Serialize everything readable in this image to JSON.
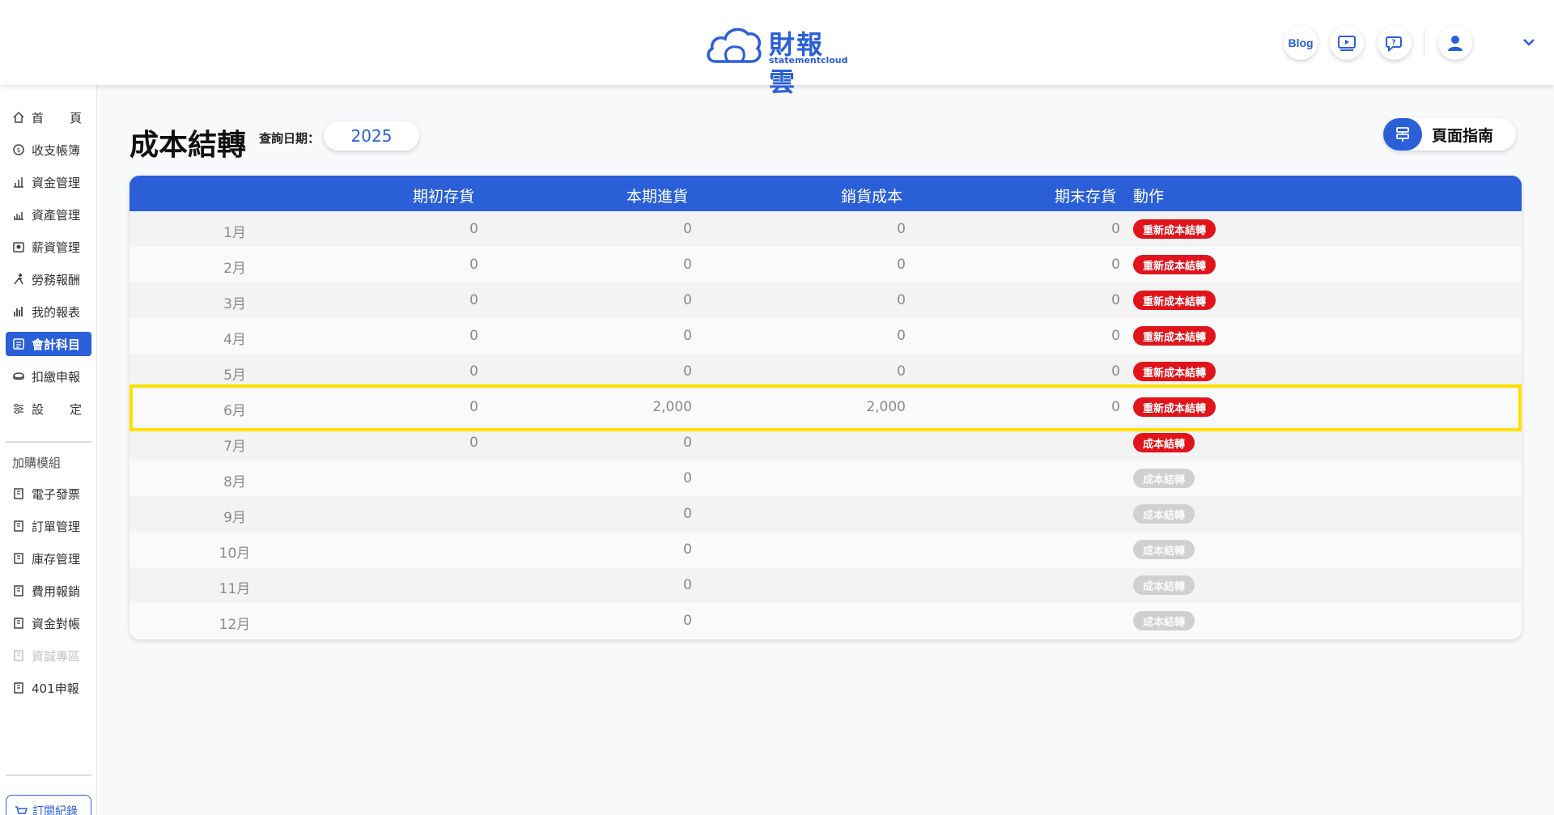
{
  "header": {
    "logo_text": "財報雲",
    "logo_sub": "statementcloud",
    "blog_label": "Blog",
    "icons": [
      "video-icon",
      "chat-question-icon",
      "user-icon",
      "chevron-down-icon"
    ]
  },
  "sidebar": {
    "items": [
      {
        "label_a": "首",
        "label_b": "頁",
        "icon": "home-icon"
      },
      {
        "label": "收支帳簿",
        "icon": "ledger-icon"
      },
      {
        "label": "資金管理",
        "icon": "fund-icon"
      },
      {
        "label": "資產管理",
        "icon": "asset-icon"
      },
      {
        "label": "薪資管理",
        "icon": "salary-icon"
      },
      {
        "label": "勞務報酬",
        "icon": "labor-icon"
      },
      {
        "label": "我的報表",
        "icon": "report-icon"
      },
      {
        "label": "會計科目",
        "icon": "account-icon"
      },
      {
        "label": "扣繳申報",
        "icon": "withholding-icon"
      },
      {
        "label_a": "設",
        "label_b": "定",
        "icon": "settings-icon"
      }
    ],
    "section_title": "加購模組",
    "addons": [
      {
        "label": "電子發票"
      },
      {
        "label": "訂單管理"
      },
      {
        "label": "庫存管理"
      },
      {
        "label": "費用報銷"
      },
      {
        "label": "資金對帳"
      },
      {
        "label": "資誠專區"
      },
      {
        "label": "401申報"
      }
    ],
    "subscription_label": "訂閱紀錄"
  },
  "main": {
    "title": "成本結轉",
    "date_label": "查詢日期：",
    "date_value": "2025",
    "guide_label": "頁面指南"
  },
  "table": {
    "headers": [
      "期初存貨",
      "本期進貨",
      "銷貨成本",
      "期末存貨",
      "動作"
    ],
    "rows": [
      {
        "month": "1月",
        "opening": "0",
        "purchase": "0",
        "cogs": "0",
        "closing": "0",
        "action": "重新成本結轉",
        "action_style": "red"
      },
      {
        "month": "2月",
        "opening": "0",
        "purchase": "0",
        "cogs": "0",
        "closing": "0",
        "action": "重新成本結轉",
        "action_style": "red"
      },
      {
        "month": "3月",
        "opening": "0",
        "purchase": "0",
        "cogs": "0",
        "closing": "0",
        "action": "重新成本結轉",
        "action_style": "red"
      },
      {
        "month": "4月",
        "opening": "0",
        "purchase": "0",
        "cogs": "0",
        "closing": "0",
        "action": "重新成本結轉",
        "action_style": "red"
      },
      {
        "month": "5月",
        "opening": "0",
        "purchase": "0",
        "cogs": "0",
        "closing": "0",
        "action": "重新成本結轉",
        "action_style": "red"
      },
      {
        "month": "6月",
        "opening": "0",
        "purchase": "2,000",
        "cogs": "2,000",
        "closing": "0",
        "action": "重新成本結轉",
        "action_style": "red"
      },
      {
        "month": "7月",
        "opening": "0",
        "purchase": "0",
        "cogs": "",
        "closing": "",
        "action": "成本結轉",
        "action_style": "red"
      },
      {
        "month": "8月",
        "opening": "",
        "purchase": "0",
        "cogs": "",
        "closing": "",
        "action": "成本結轉",
        "action_style": "gray"
      },
      {
        "month": "9月",
        "opening": "",
        "purchase": "0",
        "cogs": "",
        "closing": "",
        "action": "成本結轉",
        "action_style": "gray"
      },
      {
        "month": "10月",
        "opening": "",
        "purchase": "0",
        "cogs": "",
        "closing": "",
        "action": "成本結轉",
        "action_style": "gray"
      },
      {
        "month": "11月",
        "opening": "",
        "purchase": "0",
        "cogs": "",
        "closing": "",
        "action": "成本結轉",
        "action_style": "gray"
      },
      {
        "month": "12月",
        "opening": "",
        "purchase": "0",
        "cogs": "",
        "closing": "",
        "action": "成本結轉",
        "action_style": "gray"
      }
    ]
  },
  "colors": {
    "brand": "#2a5fd8",
    "danger": "#e1141b",
    "disabled": "#d0d0d0",
    "highlight": "#ffe100"
  }
}
